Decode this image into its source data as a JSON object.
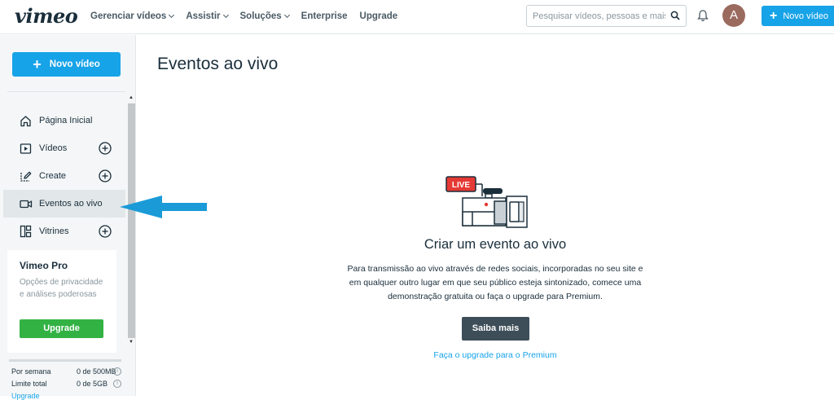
{
  "topbar": {
    "logo": "vimeo",
    "nav": [
      {
        "label": "Gerenciar vídeos",
        "dropdown": true
      },
      {
        "label": "Assistir",
        "dropdown": true
      },
      {
        "label": "Soluções",
        "dropdown": true
      },
      {
        "label": "Enterprise",
        "dropdown": false
      },
      {
        "label": "Upgrade",
        "dropdown": false
      }
    ],
    "search_placeholder": "Pesquisar vídeos, pessoas e mais",
    "avatar_initial": "A",
    "new_video_label": "Novo vídeo"
  },
  "sidebar": {
    "new_video_label": "Novo vídeo",
    "items": [
      {
        "label": "Página Inicial",
        "icon": "home-icon",
        "addable": false,
        "active": false
      },
      {
        "label": "Vídeos",
        "icon": "video-play-icon",
        "addable": true,
        "active": false
      },
      {
        "label": "Create",
        "icon": "create-edit-icon",
        "addable": true,
        "active": false
      },
      {
        "label": "Eventos ao vivo",
        "icon": "camera-icon",
        "addable": false,
        "active": true
      },
      {
        "label": "Vitrines",
        "icon": "showcase-icon",
        "addable": true,
        "active": false
      }
    ],
    "pro": {
      "title": "Vimeo Pro",
      "description": "Opções de privacidade e análises poderosas",
      "button": "Upgrade"
    },
    "storage": {
      "weekly_label": "Por semana",
      "weekly_value": "0 de 500MB",
      "total_label": "Limite total",
      "total_value": "0 de 5GB",
      "upgrade_link": "Upgrade"
    }
  },
  "main": {
    "page_title": "Eventos ao vivo",
    "live_badge": "LIVE",
    "empty_title": "Criar um evento ao vivo",
    "empty_description": "Para transmissão ao vivo através de redes sociais, incorporadas no seu site e em qualquer outro lugar em que seu público esteja sintonizado, comece uma demonstração gratuita ou faça o upgrade para Premium.",
    "learn_more_button": "Saiba mais",
    "premium_link": "Faça o upgrade para o Premium"
  },
  "colors": {
    "accent": "#17a3e8",
    "upgrade_green": "#33b244",
    "dark_button": "#3d4e59",
    "live_red": "#e53935",
    "annotation_arrow": "#1a9bd8"
  }
}
